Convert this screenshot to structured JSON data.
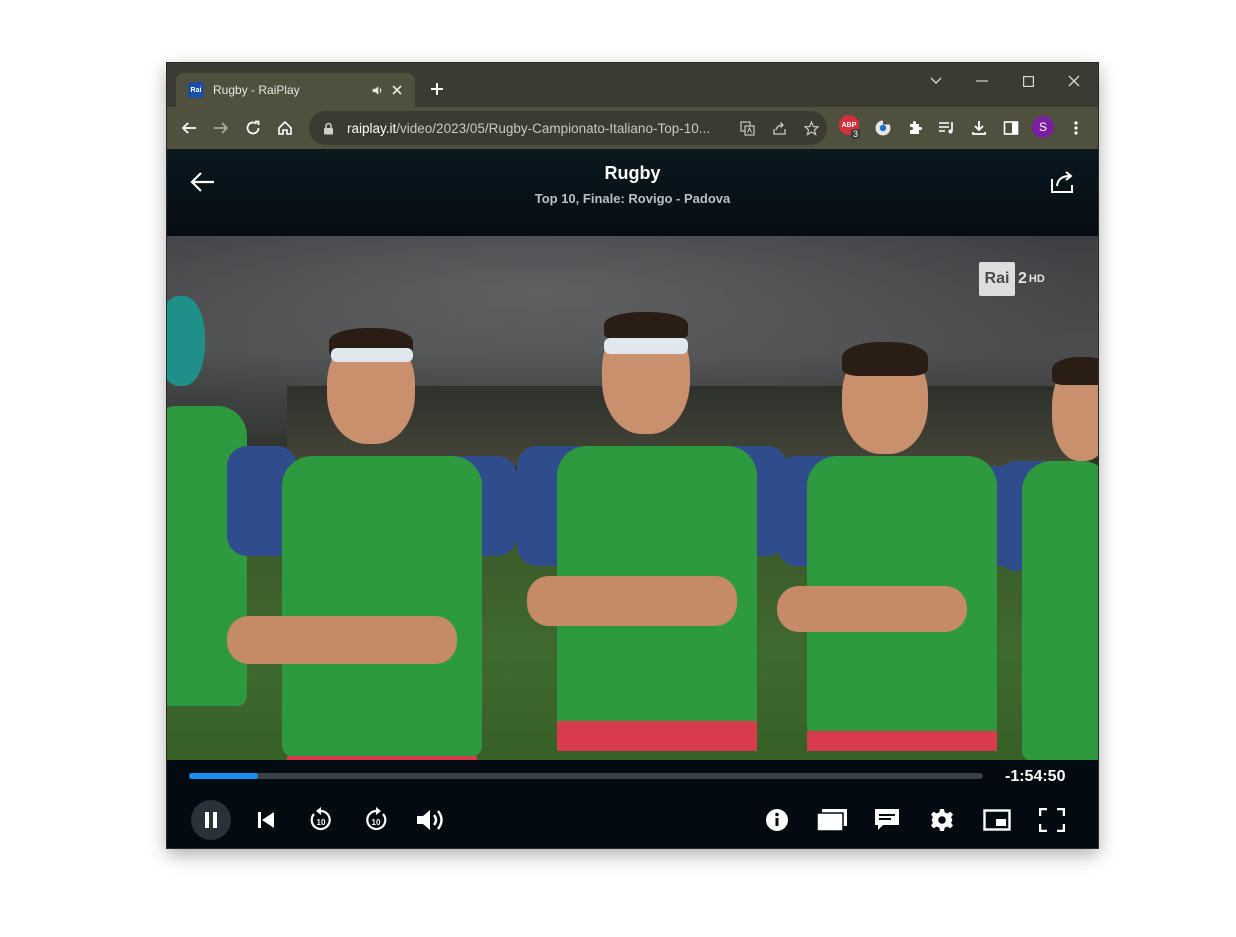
{
  "browser": {
    "tab_title": "Rugby - RaiPlay",
    "favicon_text": "Rai",
    "url_host": "raiplay.it",
    "url_path": "/video/2023/05/Rugby-Campionato-Italiano-Top-10...",
    "extension_badge_text": "ABP",
    "extension_badge_count": "3",
    "profile_initial": "S"
  },
  "player": {
    "title": "Rugby",
    "subtitle": "Top 10, Finale: Rovigo - Padova",
    "channel_logo": "Rai",
    "channel_number": "2",
    "channel_hd": "HD",
    "remaining_time": "-1:54:50",
    "progress": 0.087,
    "skip_back_seconds": "10",
    "skip_forward_seconds": "10"
  },
  "colors": {
    "accent": "#1a8ff2",
    "background": "#040c12",
    "browser_chrome": "#50503f"
  }
}
